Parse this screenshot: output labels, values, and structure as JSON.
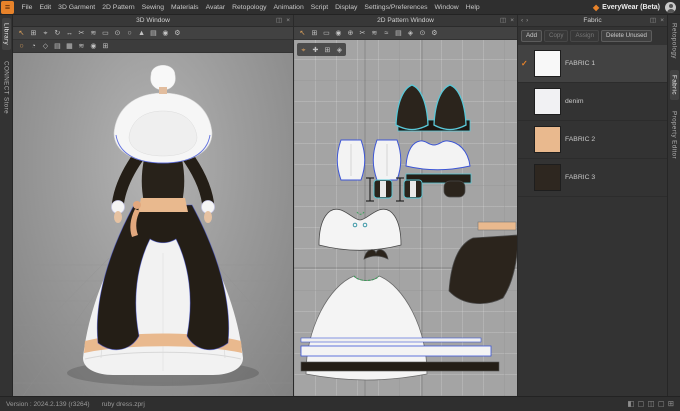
{
  "app": {
    "brand": "EveryWear (Beta)"
  },
  "menubar": {
    "items": [
      "File",
      "Edit",
      "3D Garment",
      "2D Pattern",
      "Sewing",
      "Materials",
      "Avatar",
      "Retopology",
      "Animation",
      "Script",
      "Display",
      "Settings/Preferences",
      "Window",
      "Help"
    ]
  },
  "left_rail": {
    "items": [
      {
        "label": "Library",
        "selected": true
      },
      {
        "label": "CONNECT Store",
        "selected": false
      }
    ]
  },
  "right_rail": {
    "items": [
      {
        "label": "Retopology",
        "selected": false
      },
      {
        "label": "Fabric",
        "selected": true
      },
      {
        "label": "Property Editor",
        "selected": false
      }
    ]
  },
  "view3d": {
    "title": "3D Window",
    "header_icons": [
      {
        "name": "dock",
        "glyph": "◫"
      },
      {
        "name": "close",
        "glyph": "×"
      }
    ],
    "toolbar1": [
      {
        "name": "select-tool",
        "glyph": "↖"
      },
      {
        "name": "box-select-tool",
        "glyph": "⊞"
      },
      {
        "name": "move-gizmo-tool",
        "glyph": "⌖"
      },
      {
        "name": "rotate-tool",
        "glyph": "↻"
      },
      {
        "name": "scale-tool",
        "glyph": "↔"
      },
      {
        "name": "scissors-tool",
        "glyph": "✂"
      },
      {
        "name": "sewing-tool",
        "glyph": "≋"
      },
      {
        "name": "measure-tool",
        "glyph": "▭"
      },
      {
        "name": "zoom-tool",
        "glyph": "⊙"
      },
      {
        "name": "avatar-tool",
        "glyph": "○"
      },
      {
        "name": "pose-tool",
        "glyph": "▲"
      },
      {
        "name": "fabric-tool",
        "glyph": "▤"
      },
      {
        "name": "pin-tool",
        "glyph": "◉"
      },
      {
        "name": "simulate-settings",
        "glyph": "⚙"
      }
    ],
    "toolbar2": [
      {
        "name": "show-avatar",
        "glyph": "○"
      },
      {
        "name": "show-hair",
        "glyph": "◔"
      },
      {
        "name": "show-shoes",
        "glyph": "◇"
      },
      {
        "name": "show-garment",
        "glyph": "▤"
      },
      {
        "name": "show-mesh",
        "glyph": "▦"
      },
      {
        "name": "show-seams",
        "glyph": "≋"
      },
      {
        "name": "show-pins",
        "glyph": "◉"
      },
      {
        "name": "show-grid",
        "glyph": "⊞"
      }
    ]
  },
  "view2d": {
    "title": "2D Pattern Window",
    "header_icons": [
      {
        "name": "dock",
        "glyph": "◫"
      },
      {
        "name": "close",
        "glyph": "×"
      }
    ],
    "toolbar": [
      {
        "name": "select-tool",
        "glyph": "↖"
      },
      {
        "name": "box-select-tool",
        "glyph": "⊞"
      },
      {
        "name": "pattern-tool",
        "glyph": "▭"
      },
      {
        "name": "edit-point-tool",
        "glyph": "◉"
      },
      {
        "name": "add-point-tool",
        "glyph": "⊕"
      },
      {
        "name": "scissors-tool",
        "glyph": "✂"
      },
      {
        "name": "sewing-tool",
        "glyph": "≋"
      },
      {
        "name": "free-sewing-tool",
        "glyph": "≈"
      },
      {
        "name": "grading-tool",
        "glyph": "▤"
      },
      {
        "name": "texture-tool",
        "glyph": "◈"
      },
      {
        "name": "zoom-tool",
        "glyph": "⊙"
      },
      {
        "name": "settings",
        "glyph": "⚙"
      }
    ],
    "float_icons": [
      {
        "name": "snap",
        "glyph": "⌖"
      },
      {
        "name": "pan",
        "glyph": "✚"
      },
      {
        "name": "grid-toggle",
        "glyph": "⊞"
      },
      {
        "name": "texture-view",
        "glyph": "◈"
      }
    ]
  },
  "fabric_panel": {
    "title": "Fabric",
    "header_icons_left": [
      {
        "name": "prev",
        "glyph": "‹"
      },
      {
        "name": "next",
        "glyph": "›"
      }
    ],
    "header_icons_right": [
      {
        "name": "dock",
        "glyph": "◫"
      },
      {
        "name": "close",
        "glyph": "×"
      }
    ],
    "buttons": [
      {
        "label": "Add",
        "name": "add"
      },
      {
        "label": "Copy",
        "name": "copy",
        "disabled": true
      },
      {
        "label": "Assign",
        "name": "assign",
        "disabled": true
      },
      {
        "label": "Delete Unused",
        "name": "delete-unused"
      }
    ],
    "items": [
      {
        "name": "FABRIC 1",
        "color": "#f8f8f8",
        "selected": true
      },
      {
        "name": "denim",
        "color": "#f1f1f3",
        "selected": false
      },
      {
        "name": "FABRIC 2",
        "color": "#e9b98e",
        "selected": false
      },
      {
        "name": "FABRIC 3",
        "color": "#2e2720",
        "selected": false
      }
    ]
  },
  "statusbar": {
    "version": "Version : 2024.2.139 (r3264)",
    "file": "ruby dress.zprj",
    "icons": [
      {
        "name": "layout-single",
        "glyph": "◧"
      },
      {
        "name": "layout-3d",
        "glyph": "▢"
      },
      {
        "name": "layout-split",
        "glyph": "◫"
      },
      {
        "name": "layout-2d",
        "glyph": "▢"
      },
      {
        "name": "layout-quad",
        "glyph": "⊞"
      }
    ]
  },
  "colors": {
    "accent_orange": "#e8832a",
    "selection_blue": "#3c55d6",
    "seam_teal": "#5ac8d8",
    "fabric_peach": "#e9b98e",
    "fabric_dark": "#2b241c"
  }
}
